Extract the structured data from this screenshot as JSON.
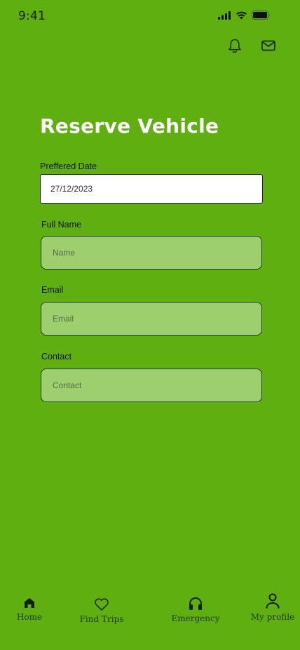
{
  "status_bar": {
    "time": "9:41"
  },
  "header": {
    "title": "Reserve Vehicle"
  },
  "form": {
    "preferred_date": {
      "label": "Preffered Date",
      "value": "27/12/2023"
    },
    "full_name": {
      "label": "Full Name",
      "placeholder": "Name"
    },
    "email": {
      "label": "Email",
      "placeholder": "Email"
    },
    "contact": {
      "label": "Contact",
      "placeholder": "Contact"
    }
  },
  "bottom_nav": {
    "items": [
      {
        "label": "Home",
        "icon": "home-icon"
      },
      {
        "label": "Find Trips",
        "icon": "heart-icon"
      },
      {
        "label": "Emergency",
        "icon": "headphones-icon"
      },
      {
        "label": "My profile",
        "icon": "user-icon"
      }
    ]
  },
  "colors": {
    "background": "#5faf11",
    "input_fill": "#9ecf6f",
    "title": "#ffffff"
  }
}
